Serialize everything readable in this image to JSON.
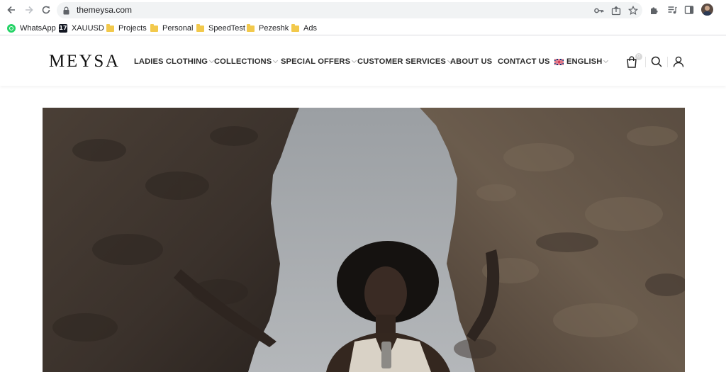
{
  "browser": {
    "url": "themeysa.com",
    "icons": {
      "back": "back-arrow-icon",
      "forward": "forward-arrow-icon",
      "reload": "reload-icon",
      "lock": "lock-icon",
      "key": "key-icon",
      "share": "share-icon",
      "star": "bookmark-star-icon",
      "extensions": "puzzle-icon",
      "media": "media-list-icon",
      "sidepanel": "side-panel-icon"
    }
  },
  "bookmarks": [
    {
      "label": "WhatsApp",
      "icon": "whatsapp-icon"
    },
    {
      "label": "XAUUSD",
      "icon": "tradingview-icon"
    },
    {
      "label": "Projects",
      "icon": "folder-icon"
    },
    {
      "label": "Personal",
      "icon": "folder-icon"
    },
    {
      "label": "SpeedTest",
      "icon": "folder-icon"
    },
    {
      "label": "Pezeshk",
      "icon": "folder-icon"
    },
    {
      "label": "Ads",
      "icon": "folder-icon"
    }
  ],
  "site": {
    "logo": "MEYSA",
    "nav": [
      {
        "label": "LADIES CLOTHING",
        "dropdown": true
      },
      {
        "label": "COLLECTIONS",
        "dropdown": true
      },
      {
        "label": "SPECIAL OFFERS",
        "dropdown": true
      },
      {
        "label": "CUSTOMER SERVICES",
        "dropdown": true
      },
      {
        "label": "ABOUT US",
        "dropdown": false
      },
      {
        "label": "CONTACT US",
        "dropdown": false
      },
      {
        "label": "ENGLISH",
        "dropdown": true,
        "flag": "uk-flag-icon"
      }
    ],
    "cart_count": "0",
    "header_icons": [
      "shopping-bag-icon",
      "search-icon",
      "account-icon"
    ]
  },
  "colors": {
    "text": "#2b2b2b",
    "omnibox_bg": "#f1f3f4",
    "folder": "#f2c94c",
    "whatsapp": "#25d366"
  }
}
